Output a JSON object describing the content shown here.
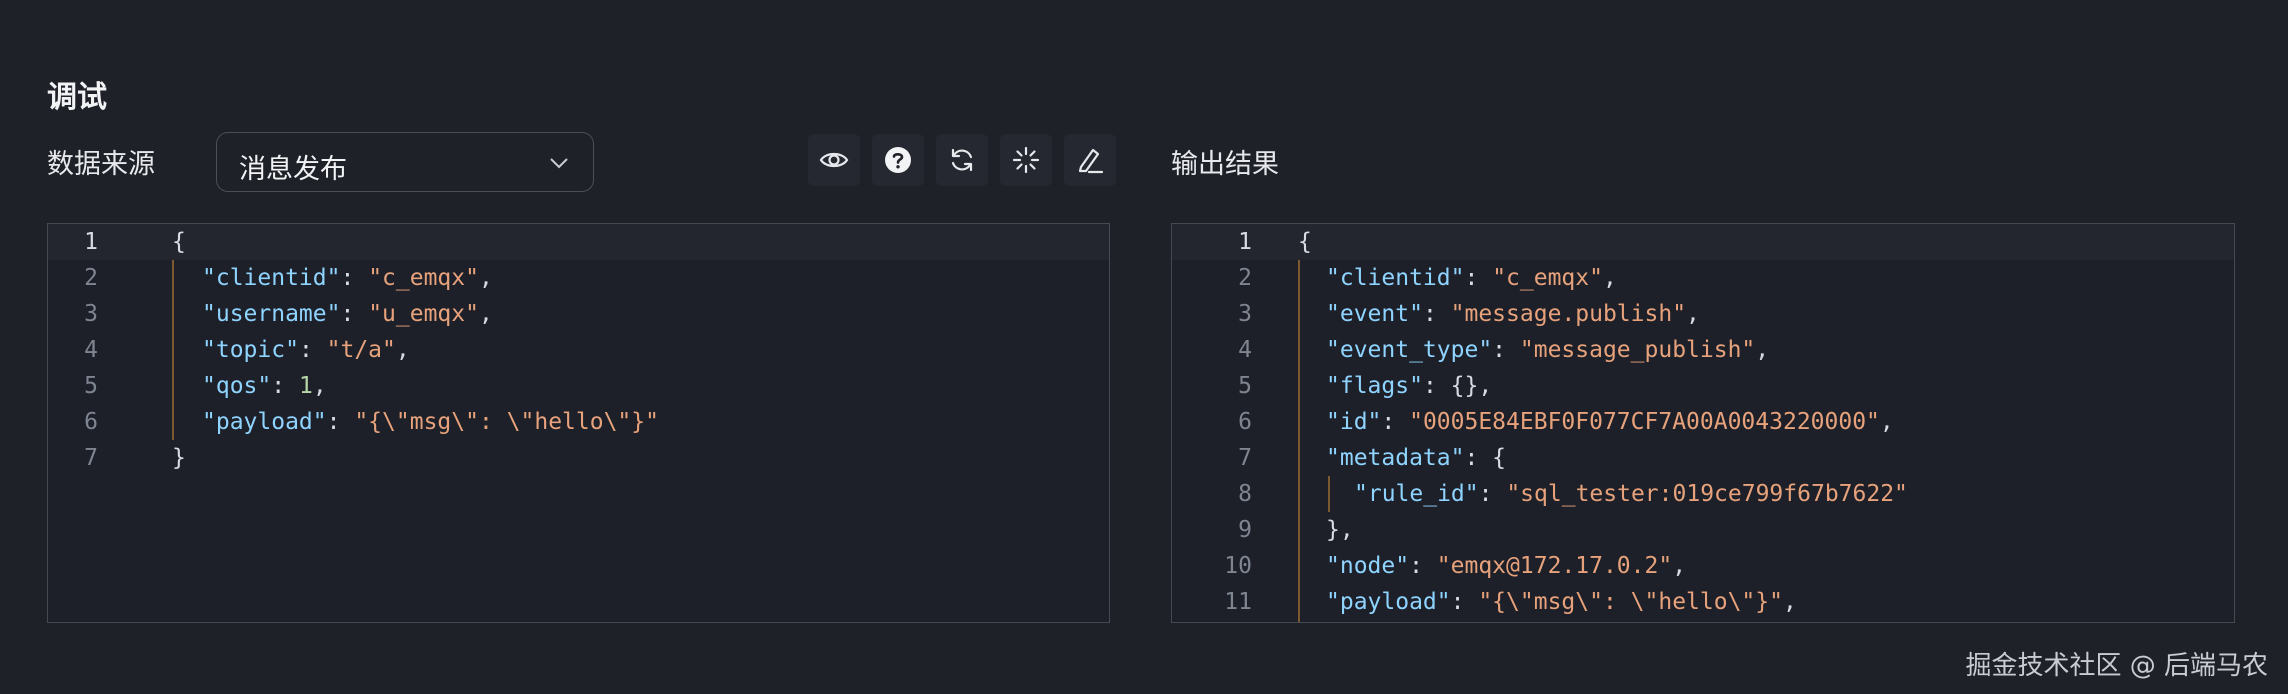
{
  "section_title": "调试",
  "source": {
    "label": "数据来源",
    "selected": "消息发布"
  },
  "toolbar": {
    "buttons": [
      {
        "icon": "eye-icon"
      },
      {
        "icon": "help-icon"
      },
      {
        "icon": "refresh-icon"
      },
      {
        "icon": "loading-sparkle-icon"
      },
      {
        "icon": "clear-edit-icon"
      }
    ]
  },
  "output": {
    "label": "输出结果"
  },
  "left_editor": {
    "lines": [
      [
        [
          "p",
          "{"
        ]
      ],
      [
        [
          "k",
          "\"clientid\""
        ],
        [
          "p",
          ": "
        ],
        [
          "s",
          "\"c_emqx\""
        ],
        [
          "p",
          ","
        ]
      ],
      [
        [
          "k",
          "\"username\""
        ],
        [
          "p",
          ": "
        ],
        [
          "s",
          "\"u_emqx\""
        ],
        [
          "p",
          ","
        ]
      ],
      [
        [
          "k",
          "\"topic\""
        ],
        [
          "p",
          ": "
        ],
        [
          "s",
          "\"t/a\""
        ],
        [
          "p",
          ","
        ]
      ],
      [
        [
          "k",
          "\"qos\""
        ],
        [
          "p",
          ": "
        ],
        [
          "n",
          "1"
        ],
        [
          "p",
          ","
        ]
      ],
      [
        [
          "k",
          "\"payload\""
        ],
        [
          "p",
          ": "
        ],
        [
          "s",
          "\"{\\\"msg\\\": \\\"hello\\\"}\""
        ]
      ],
      [
        [
          "p",
          "}"
        ]
      ]
    ]
  },
  "right_editor": {
    "lines": [
      [
        [
          "p",
          "{"
        ]
      ],
      [
        [
          "k",
          "\"clientid\""
        ],
        [
          "p",
          ": "
        ],
        [
          "s",
          "\"c_emqx\""
        ],
        [
          "p",
          ","
        ]
      ],
      [
        [
          "k",
          "\"event\""
        ],
        [
          "p",
          ": "
        ],
        [
          "s",
          "\"message.publish\""
        ],
        [
          "p",
          ","
        ]
      ],
      [
        [
          "k",
          "\"event_type\""
        ],
        [
          "p",
          ": "
        ],
        [
          "s",
          "\"message_publish\""
        ],
        [
          "p",
          ","
        ]
      ],
      [
        [
          "k",
          "\"flags\""
        ],
        [
          "p",
          ": {},"
        ]
      ],
      [
        [
          "k",
          "\"id\""
        ],
        [
          "p",
          ": "
        ],
        [
          "s",
          "\"0005E84EBF0F077CF7A00A0043220000\""
        ],
        [
          "p",
          ","
        ]
      ],
      [
        [
          "k",
          "\"metadata\""
        ],
        [
          "p",
          ": {"
        ]
      ],
      [
        [
          "k",
          "\"rule_id\""
        ],
        [
          "p",
          ": "
        ],
        [
          "s",
          "\"sql_tester:019ce799f67b7622\""
        ]
      ],
      [
        [
          "p",
          "},"
        ]
      ],
      [
        [
          "k",
          "\"node\""
        ],
        [
          "p",
          ": "
        ],
        [
          "s",
          "\"emqx@172.17.0.2\""
        ],
        [
          "p",
          ","
        ]
      ],
      [
        [
          "k",
          "\"payload\""
        ],
        [
          "p",
          ": "
        ],
        [
          "s",
          "\"{\\\"msg\\\": \\\"hello\\\"}\""
        ],
        [
          "p",
          ","
        ]
      ]
    ]
  },
  "watermark": "掘金技术社区 @ 后端马农"
}
